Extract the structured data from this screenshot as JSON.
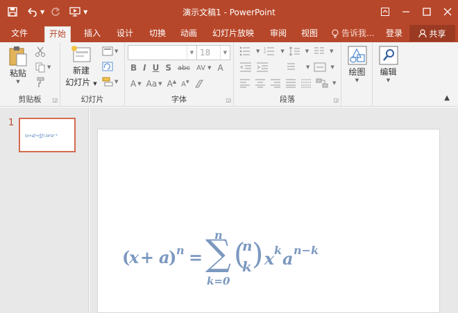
{
  "titlebar": {
    "title": "演示文稿1 - PowerPoint",
    "qat": {
      "save_icon": "save-icon",
      "undo_icon": "undo-icon",
      "redo_icon": "redo-icon",
      "present_icon": "present-from-start-icon"
    }
  },
  "tabs": [
    {
      "label": "文件",
      "active": false
    },
    {
      "label": "开始",
      "active": true
    },
    {
      "label": "插入",
      "active": false
    },
    {
      "label": "设计",
      "active": false
    },
    {
      "label": "切换",
      "active": false
    },
    {
      "label": "动画",
      "active": false
    },
    {
      "label": "幻灯片放映",
      "active": false
    },
    {
      "label": "审阅",
      "active": false
    },
    {
      "label": "视图",
      "active": false
    }
  ],
  "tellme": "告诉我...",
  "login": "登录",
  "share": "共享",
  "ribbon": {
    "clipboard": {
      "label": "剪贴板",
      "paste": "粘贴"
    },
    "slides": {
      "label": "幻灯片",
      "new_slide_1": "新建",
      "new_slide_2": "幻灯片"
    },
    "font": {
      "label": "字体",
      "font_name": "",
      "font_size": "18",
      "size_placeholder": "18"
    },
    "paragraph": {
      "label": "段落"
    },
    "drawing": {
      "label": "",
      "draw": "绘图"
    },
    "editing": {
      "label": "",
      "edit": "编辑"
    }
  },
  "slides_pane": {
    "slide_number": "1"
  },
  "equation": {
    "lhs_open": "(",
    "lhs_x": "x",
    "lhs_plus": " + ",
    "lhs_a": "a",
    "lhs_close": ")",
    "lhs_exp": "n",
    "eq": "=",
    "sum_upper": "n",
    "sum_symbol": "∑",
    "sum_lower": "k=0",
    "binom_top": "n",
    "binom_bottom": "k",
    "term_x": "x",
    "term_x_exp": "k",
    "term_a": "a",
    "term_a_exp": "n−k"
  },
  "colors": {
    "accent": "#b7472a",
    "equation": "#7b98bf"
  }
}
